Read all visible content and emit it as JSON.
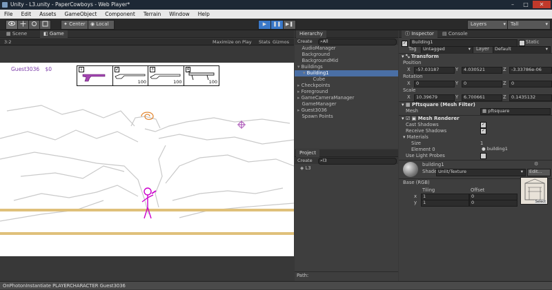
{
  "window": {
    "title": "Unity - L3.unity - PaperCowboys - Web Player*",
    "minimize": "–",
    "maximize": "□",
    "close": "✕"
  },
  "menu": [
    "File",
    "Edit",
    "Assets",
    "GameObject",
    "Component",
    "Terrain",
    "Window",
    "Help"
  ],
  "toolbar": {
    "pivot_center": "Center",
    "pivot_local": "Local",
    "play": "▶",
    "pause": "❚❚",
    "step": "▶❚",
    "layers": "Layers",
    "layout": "Tall"
  },
  "scene_tabs": {
    "scene": "Scene",
    "game": "Game"
  },
  "game_bar": {
    "aspect": "3:2",
    "maximize": "Maximize on Play",
    "stats": "Stats",
    "gizmos": "Gizmos"
  },
  "game": {
    "player": "Guest3036",
    "money": "$0",
    "weapons": [
      {
        "key": "1",
        "ammo": ""
      },
      {
        "key": "2",
        "ammo": "100"
      },
      {
        "key": "3",
        "ammo": "100"
      },
      {
        "key": "4",
        "ammo": "100"
      }
    ]
  },
  "hierarchy": {
    "title": "Hierarchy",
    "create": "Create",
    "search": "All",
    "items": [
      {
        "label": "AudioManager",
        "indent": 0,
        "arrow": false
      },
      {
        "label": "Background",
        "indent": 0,
        "arrow": false
      },
      {
        "label": "BackgroundMid",
        "indent": 0,
        "arrow": false
      },
      {
        "label": "Buildings",
        "indent": 0,
        "arrow": true,
        "open": true
      },
      {
        "label": "Building1",
        "indent": 1,
        "arrow": true,
        "open": true,
        "selected": true
      },
      {
        "label": "Cube",
        "indent": 2,
        "arrow": false
      },
      {
        "label": "Checkpoints",
        "indent": 0,
        "arrow": true
      },
      {
        "label": "Foreground",
        "indent": 0,
        "arrow": true
      },
      {
        "label": "GameCameraManager",
        "indent": 0,
        "arrow": true
      },
      {
        "label": "GameManager",
        "indent": 0,
        "arrow": false
      },
      {
        "label": "Guest3036",
        "indent": 0,
        "arrow": true
      },
      {
        "label": "Spawn Points",
        "indent": 0,
        "arrow": false
      }
    ]
  },
  "project": {
    "title": "Project",
    "create": "Create",
    "search": "l3",
    "items": [
      "L3"
    ],
    "path_label": "Path:"
  },
  "inspector": {
    "tabs": [
      "Inspector",
      "Console"
    ],
    "object_name": "Building1",
    "static_label": "Static",
    "tag_label": "Tag",
    "tag_value": "Untagged",
    "layer_label": "Layer",
    "layer_value": "Default",
    "transform": {
      "title": "Transform",
      "position_label": "Position",
      "rotation_label": "Rotation",
      "scale_label": "Scale",
      "position": {
        "x": "-57.03187",
        "y": "4.030521",
        "z": "-3.33786e-06"
      },
      "rotation": {
        "x": "0",
        "y": "0",
        "z": "0"
      },
      "scale": {
        "x": "10.39679",
        "y": "6.700661",
        "z": "0.1435132"
      }
    },
    "mesh_filter": {
      "title": "Pftsquare (Mesh Filter)",
      "mesh_label": "Mesh",
      "mesh_value": "pftsquare"
    },
    "mesh_renderer": {
      "title": "Mesh Renderer",
      "cast_shadows": "Cast Shadows",
      "receive_shadows": "Receive Shadows",
      "materials": "Materials",
      "size_label": "Size",
      "size_value": "1",
      "element_label": "Element 0",
      "element_value": "building1",
      "light_probes": "Use Light Probes"
    },
    "material": {
      "name": "building1",
      "shader_label": "Shader",
      "shader_value": "Unlit/Texture",
      "edit": "Edit...",
      "base_label": "Base (RGB)",
      "tiling_label": "Tiling",
      "offset_label": "Offset",
      "x_label": "x",
      "y_label": "y",
      "tiling_x": "1",
      "tiling_y": "1",
      "offset_x": "0",
      "offset_y": "0",
      "select": "Select"
    }
  },
  "status": "OnPhotonInstantiate PLAYERCHARACTER Guest3036",
  "colors": {
    "accent": "#3a78c8",
    "selection": "#4a6fa5",
    "player": "#cc00cc",
    "ground": "#dfc07a"
  }
}
